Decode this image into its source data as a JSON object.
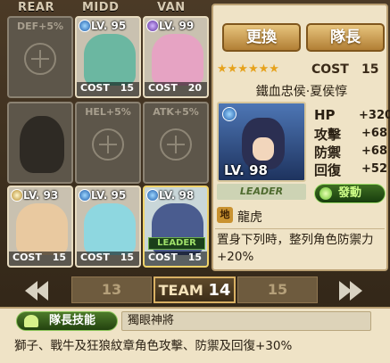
{
  "formation": {
    "headers": [
      "REAR",
      "MIDD",
      "VAN"
    ],
    "top_row": [
      {
        "bonus": "DEF+5%",
        "empty": true
      },
      {
        "lv": "LV. 95",
        "cost_label": "COST",
        "cost": "15",
        "attr": "water",
        "color": "#6bb7a1"
      },
      {
        "lv": "LV. 99",
        "cost_label": "COST",
        "cost": "20",
        "attr": "dark",
        "color": "#e6a3c3"
      }
    ],
    "mid_row": [
      {
        "silhouette": true
      },
      {
        "bonus": "HEL+5%",
        "empty": true
      },
      {
        "bonus": "ATK+5%",
        "empty": true
      }
    ],
    "bottom_row": [
      {
        "lv": "LV. 93",
        "cost_label": "COST",
        "cost": "15",
        "attr": "light",
        "color": "#e9c9a0"
      },
      {
        "lv": "LV. 95",
        "cost_label": "COST",
        "cost": "15",
        "attr": "water",
        "color": "#8ed7e0"
      },
      {
        "lv": "LV. 98",
        "cost_label": "COST",
        "cost": "15",
        "attr": "water",
        "color": "#4a5c8f",
        "leader": "LEADER"
      }
    ]
  },
  "panel": {
    "swap_button": "更換",
    "leader_button": "隊長",
    "stars": "★★★★★★",
    "cost_label": "COST",
    "cost_value": "15",
    "character_name": "鐵血忠侯·夏侯惇",
    "portrait_lv": "LV. 98",
    "stats": [
      {
        "label": "HP",
        "value": "+320"
      },
      {
        "label": "攻擊",
        "value": "+68"
      },
      {
        "label": "防禦",
        "value": "+68"
      },
      {
        "label": "回復",
        "value": "+52"
      }
    ],
    "leader_tag": "LEADER",
    "activate_button": "發動",
    "skill_icon": "地",
    "skill_name": "龍虎",
    "skill_description": "置身下列時，整列角色防禦力+20%"
  },
  "pager": {
    "prev_team": "13",
    "current_prefix": "TEAM",
    "current_team": "14",
    "next_team": "15"
  },
  "leader_skill": {
    "badge": "隊長技能",
    "name": "獨眼神將",
    "description": "獅子、戰牛及狂狼紋章角色攻擊、防禦及回復+30%"
  }
}
